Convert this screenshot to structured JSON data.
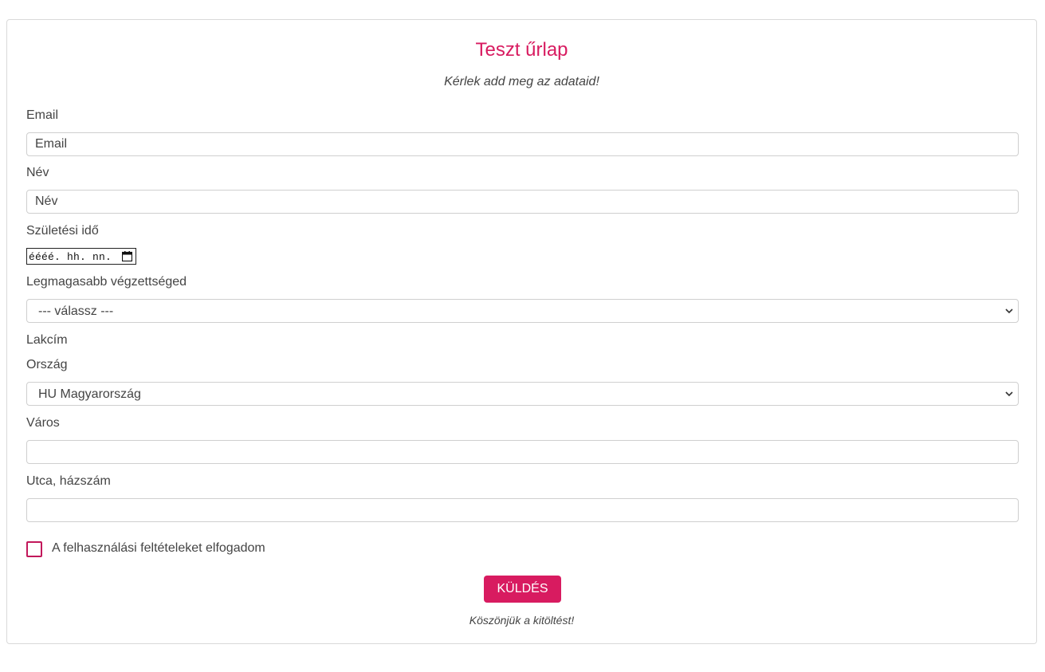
{
  "form": {
    "title": "Teszt űrlap",
    "subtitle": "Kérlek add meg az adataid!",
    "email": {
      "label": "Email",
      "placeholder": "Email",
      "value": ""
    },
    "name": {
      "label": "Név",
      "placeholder": "Név",
      "value": ""
    },
    "birthdate": {
      "label": "Születési idő",
      "value": "éééé. hh. nn.",
      "icon": "calendar-icon"
    },
    "education": {
      "label": "Legmagasabb végzettséged",
      "selected": "--- válassz ---",
      "icon": "chevron-down-icon"
    },
    "address": {
      "label": "Lakcím",
      "country": {
        "label": "Ország",
        "selected": "HU Magyarország",
        "icon": "chevron-down-icon"
      },
      "city": {
        "label": "Város",
        "value": ""
      },
      "street": {
        "label": "Utca, házszám",
        "value": ""
      }
    },
    "terms": {
      "label": "A felhasználási feltételeket elfogadom",
      "checked": false
    },
    "submit_label": "KÜLDÉS",
    "thanks": "Köszönjük a kitöltést!"
  },
  "colors": {
    "accent": "#d81b60",
    "text": "#444444",
    "border": "#cfcfcf"
  }
}
